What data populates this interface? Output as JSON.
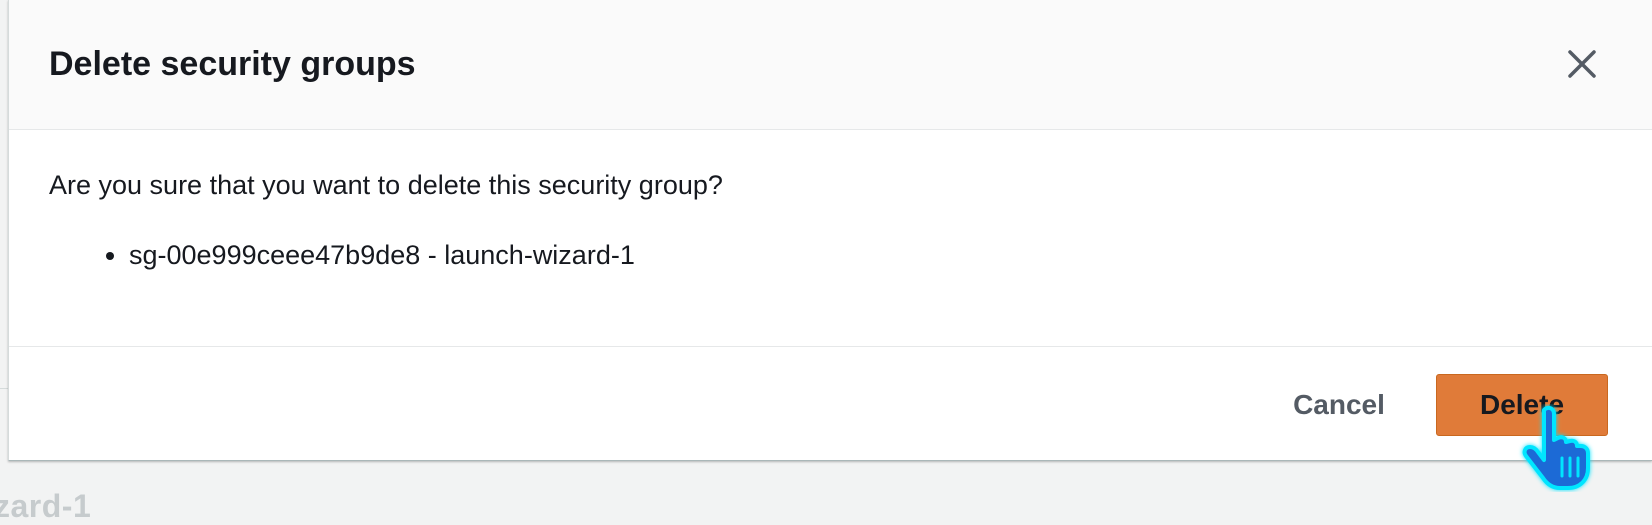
{
  "backdrop": {
    "partial_text": "zard-1"
  },
  "modal": {
    "title": "Delete security groups",
    "question": "Are you sure that you want to delete this security group?",
    "groups": [
      {
        "label": "sg-00e999ceee47b9de8 - launch-wizard-1"
      }
    ],
    "cancel_label": "Cancel",
    "delete_label": "Delete",
    "colors": {
      "primary_button": "#e07b39",
      "cursor": "#1f6bd6",
      "cursor_glow": "#00e5ff"
    },
    "icons": {
      "close": "close-icon",
      "cursor": "hand-pointer-icon"
    }
  }
}
